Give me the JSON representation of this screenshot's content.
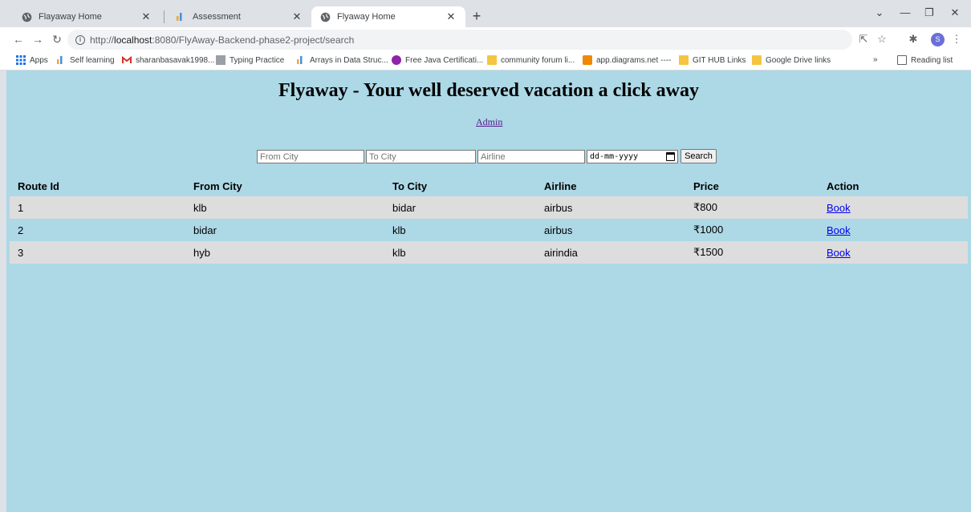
{
  "browser": {
    "tabs": [
      {
        "label": "Flayaway Home",
        "icon": "globe-icon",
        "active": false
      },
      {
        "label": "Assessment",
        "icon": "bar-logo-icon",
        "active": false
      },
      {
        "label": "Flyaway Home",
        "icon": "globe-icon",
        "active": true
      }
    ],
    "new_tab": "+",
    "url_prefix": "http://",
    "url_host": "localhost",
    "url_rest": ":8080/FlyAway-Backend-phase2-project/search",
    "profile_initial": "S",
    "bookmarks": [
      {
        "label": "Apps",
        "icon": "apps-grid-icon"
      },
      {
        "label": "Self learning",
        "icon": "bar-logo-icon"
      },
      {
        "label": "sharanbasavak1998...",
        "icon": "gmail-icon"
      },
      {
        "label": "Typing Practice",
        "icon": "page-icon"
      },
      {
        "label": "Arrays in Data Struc...",
        "icon": "bar-logo-icon"
      },
      {
        "label": "Free Java Certificati...",
        "icon": "circle-logo-icon"
      },
      {
        "label": "community forum li...",
        "icon": "folder-icon"
      },
      {
        "label": "app.diagrams.net ----",
        "icon": "diagrams-icon"
      },
      {
        "label": "GIT HUB Links",
        "icon": "folder-icon"
      },
      {
        "label": "Google Drive links",
        "icon": "folder-icon"
      }
    ],
    "overflow": "»",
    "reading_list": "Reading list"
  },
  "page": {
    "title": "Flyaway - Your well deserved vacation a click away",
    "admin_link": "Admin",
    "search": {
      "from_placeholder": "From City",
      "to_placeholder": "To City",
      "airline_placeholder": "Airline",
      "date_placeholder": "dd-mm-yyyy",
      "button": "Search"
    },
    "table": {
      "headers": [
        "Route Id",
        "From City",
        "To City",
        "Airline",
        "Price",
        "Action"
      ],
      "rows": [
        {
          "id": "1",
          "from": "klb",
          "to": "bidar",
          "airline": "airbus",
          "price": "₹800",
          "action": "Book"
        },
        {
          "id": "2",
          "from": "bidar",
          "to": "klb",
          "airline": "airbus",
          "price": "₹1000",
          "action": "Book"
        },
        {
          "id": "3",
          "from": "hyb",
          "to": "klb",
          "airline": "airindia",
          "price": "₹1500",
          "action": "Book"
        }
      ]
    }
  },
  "colors": {
    "page_bg": "#add8e6",
    "row_alt": "#dddddd",
    "link": "#0000ee",
    "visited_link": "#551a8b"
  }
}
